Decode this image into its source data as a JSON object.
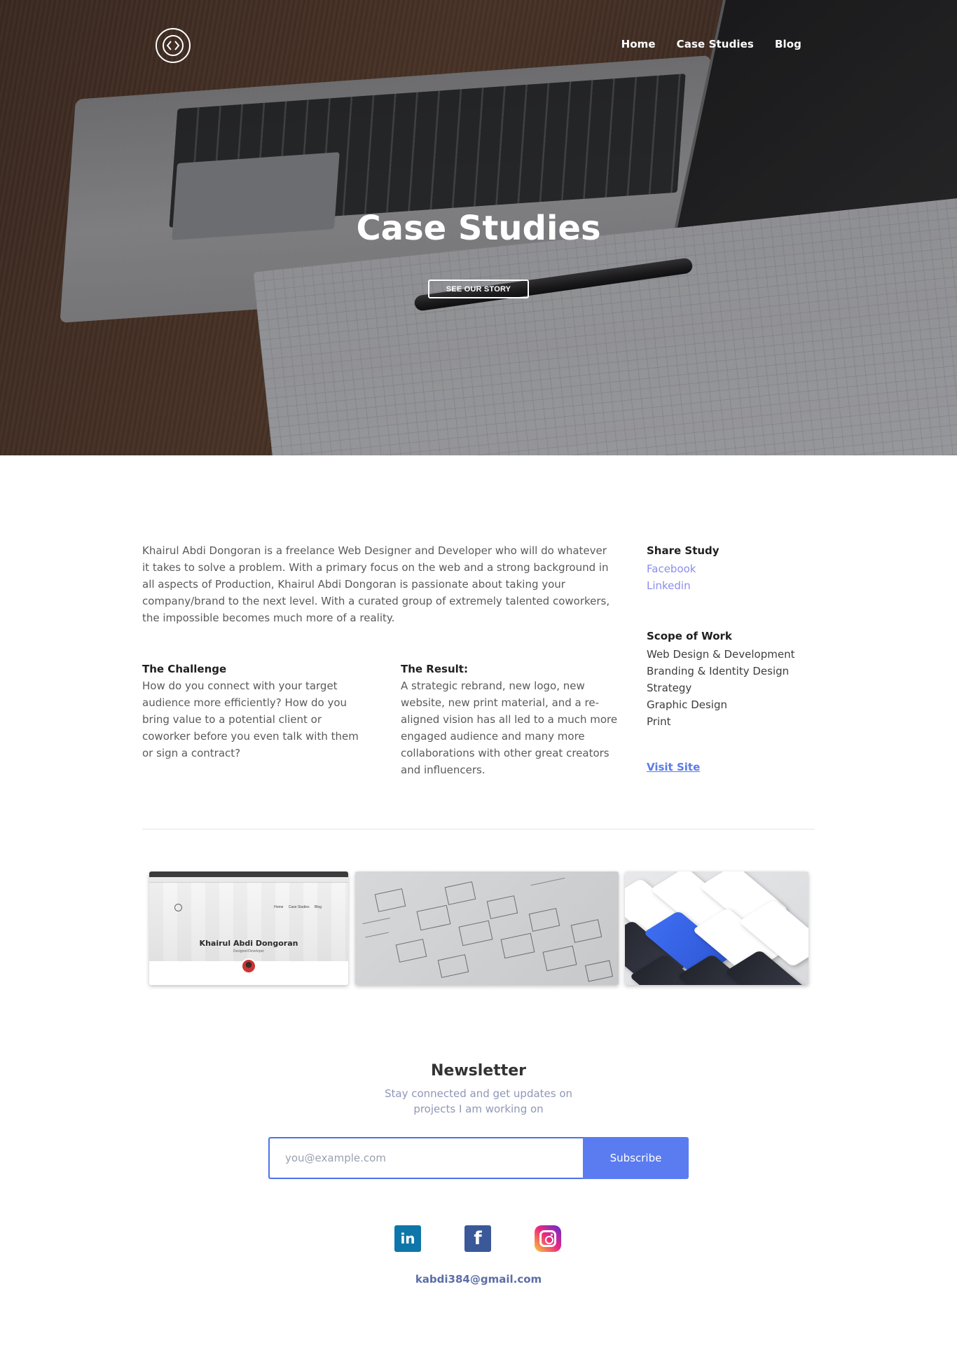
{
  "nav": {
    "logo_icon": "code-brackets-circle-icon",
    "links": [
      {
        "label": "Home"
      },
      {
        "label": "Case Studies"
      },
      {
        "label": "Blog"
      }
    ]
  },
  "hero": {
    "title": "Case Studies",
    "button_label": "SEE OUR STORY"
  },
  "intro": {
    "text": "Khairul Abdi Dongoran is a freelance Web Designer and Developer who will do whatever it takes to solve a problem. With a primary focus on the web and a strong background in all aspects of Production, Khairul Abdi Dongoran is passionate about taking your company/brand to the next level. With a curated group of extremely talented coworkers, the impossible becomes much more of a reality."
  },
  "challenge": {
    "title": "The Challenge",
    "text": "How do you connect with your target audience more efficiently? How do you bring value to a potential client or coworker before you even talk with them or sign a contract?"
  },
  "result": {
    "title": "The Result:",
    "text": "A strategic rebrand, new logo, new website, new print material, and a re-aligned vision has all led to a much more engaged audience and many more collaborations with other great creators and influencers."
  },
  "share": {
    "title": "Share Study",
    "links": [
      "Facebook",
      "Linkedin"
    ]
  },
  "scope": {
    "title": "Scope of Work",
    "items": [
      "Web Design & Development",
      "Branding & Identity Design",
      "Strategy",
      "Graphic Design",
      "Print"
    ]
  },
  "visit_label": "Visit Site",
  "gallery": {
    "thumb1": {
      "title": "Khairul Abdi Dongoran",
      "subtitle": "Designer/Developer",
      "nav": [
        "Home",
        "Case Studies",
        "Blog"
      ]
    }
  },
  "newsletter": {
    "title": "Newsletter",
    "subtitle": "Stay connected and get updates on projects I am working on",
    "placeholder": "you@example.com",
    "button_label": "Subscribe"
  },
  "socials": [
    {
      "icon": "linkedin-icon",
      "glyph": "in"
    },
    {
      "icon": "facebook-icon",
      "glyph": "f"
    },
    {
      "icon": "instagram-icon"
    }
  ],
  "contact_email": "kabdi384@gmail.com",
  "colors": {
    "accent": "#5a7cf0",
    "link": "#8a8df0",
    "email": "#5c6ea6"
  }
}
